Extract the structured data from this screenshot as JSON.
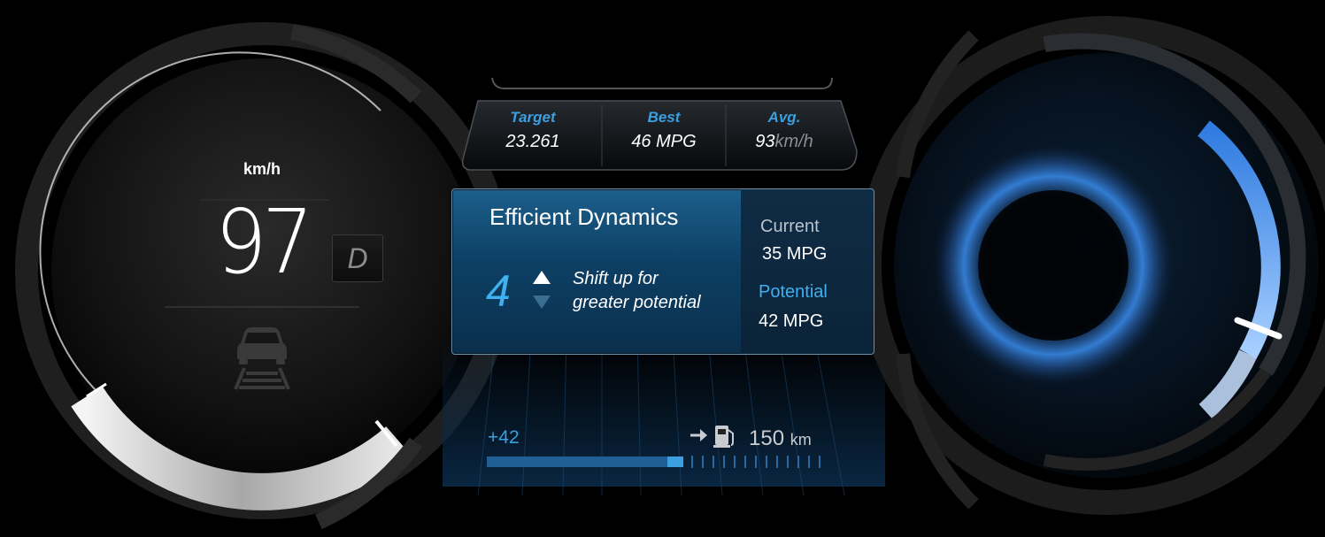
{
  "speedometer": {
    "unit": "km/h",
    "speed": "97",
    "gear": "D"
  },
  "efficiency_stats": {
    "target_label": "Target",
    "target_value": "23.261",
    "best_label": "Best",
    "best_value": "46 MPG",
    "avg_label": "Avg.",
    "avg_value": "93",
    "avg_unit": "km/h"
  },
  "efficient_dynamics": {
    "title": "Efficient Dynamics",
    "recommended_gear": "4",
    "message_line1": "Shift up for",
    "message_line2": "greater potential",
    "current_label": "Current",
    "current_value": "35 MPG",
    "potential_label": "Potential",
    "potential_value": "42 MPG"
  },
  "range": {
    "delta": "+42",
    "distance": "150",
    "distance_unit": "km"
  },
  "colors": {
    "accent_blue": "#3aa0e0",
    "panel_blue": "#1c5f8c",
    "background": "#000000"
  },
  "icons": [
    "car-lane-icon",
    "arrow-right-icon",
    "fuel-pump-icon",
    "shift-up-icon",
    "shift-down-icon"
  ]
}
